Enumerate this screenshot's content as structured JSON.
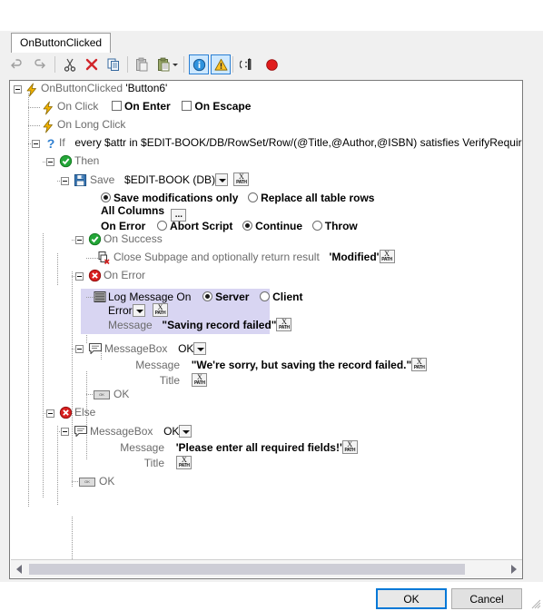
{
  "tab": {
    "label": "OnButtonClicked"
  },
  "toolbar": {
    "items": [
      {
        "name": "undo-icon",
        "title": "Undo",
        "state": "disabled"
      },
      {
        "name": "redo-icon",
        "title": "Redo",
        "state": "disabled"
      },
      {
        "name": "cut-icon",
        "title": "Cut",
        "state": "enabled"
      },
      {
        "name": "delete-icon",
        "title": "Delete",
        "state": "enabled"
      },
      {
        "name": "copy-icon",
        "title": "Copy",
        "state": "enabled"
      },
      {
        "name": "paste-icon",
        "title": "Paste",
        "state": "disabled"
      },
      {
        "name": "paste-special-icon",
        "title": "Paste Special",
        "state": "enabled"
      },
      {
        "name": "info-icon",
        "title": "Show Information",
        "state": "selected"
      },
      {
        "name": "warning-icon",
        "title": "Show Warnings",
        "state": "selected"
      },
      {
        "name": "debug-icon",
        "title": "Debug",
        "state": "enabled"
      },
      {
        "name": "breakpoint-icon",
        "title": "Breakpoint",
        "state": "enabled"
      }
    ]
  },
  "tree": {
    "root": {
      "label": "OnButtonClicked",
      "target": "'Button6'"
    },
    "on_click": {
      "label": "On Click",
      "on_enter": "On Enter",
      "on_escape": "On Escape",
      "on_enter_checked": false,
      "on_escape_checked": false
    },
    "on_long_click": {
      "label": "On Long Click"
    },
    "if": {
      "keyword": "If",
      "expression": "every $attr in $EDIT-BOOK/DB/RowSet/Row/(@Title,@Author,@ISBN) satisfies VerifyRequiredFiel"
    },
    "then": {
      "label": "Then"
    },
    "save": {
      "label": "Save",
      "target": "$EDIT-BOOK (DB)",
      "mode_modifications": "Save modifications only",
      "mode_replace": "Replace all table rows",
      "mode_selected": "modifications",
      "columns_label": "All Columns",
      "columns_button": "...",
      "on_error_label": "On Error",
      "on_error_abort": "Abort Script",
      "on_error_continue": "Continue",
      "on_error_throw": "Throw",
      "on_error_selected": "continue"
    },
    "on_success": {
      "label": "On Success",
      "child": {
        "label": "Close Subpage and optionally return result",
        "value": "'Modified'"
      }
    },
    "on_error": {
      "label": "On Error",
      "log": {
        "label": "Log Message On",
        "server": "Server",
        "client": "Client",
        "target_selected": "server",
        "severity": "Error",
        "message_label": "Message",
        "message_value": "\"Saving record failed\""
      },
      "messagebox": {
        "label": "MessageBox",
        "buttons": "OK",
        "message_label": "Message",
        "message_value": "\"We're sorry, but saving the record failed.\"",
        "title_label": "Title",
        "title_value": "",
        "branch_label": "OK"
      }
    },
    "else": {
      "label": "Else",
      "messagebox": {
        "label": "MessageBox",
        "buttons": "OK",
        "message_label": "Message",
        "message_value": "'Please enter all required fields!'",
        "title_label": "Title",
        "title_value": "",
        "branch_label": "OK"
      }
    }
  },
  "scrollbar": {
    "orientation": "horizontal"
  },
  "footer": {
    "ok": "OK",
    "cancel": "Cancel"
  },
  "colors": {
    "panel": "#f0f0f0",
    "selection": "#d8d5f2",
    "accent": "#0078d7",
    "label_gray": "#6b6b6b",
    "success_green": "#2aa02a",
    "error_red": "#d62020",
    "info_blue": "#1a7fd4",
    "warn_yellow": "#ffc425"
  }
}
